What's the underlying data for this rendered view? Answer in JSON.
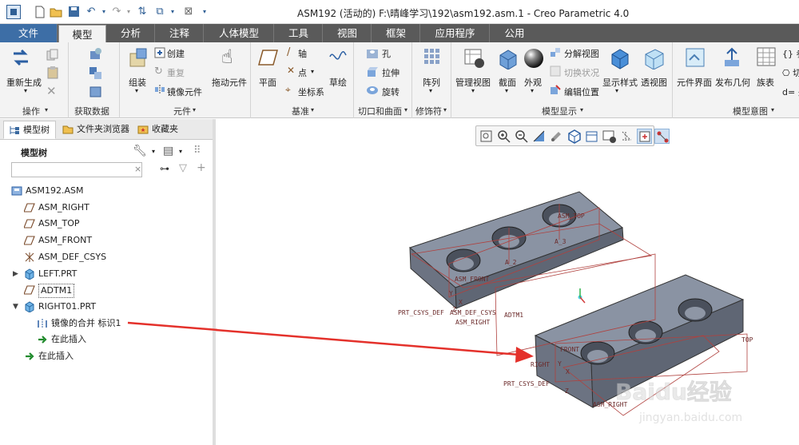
{
  "window": {
    "title": "ASM192 (活动的) F:\\晴峰学习\\192\\asm192.asm.1 - Creo Parametric 4.0"
  },
  "tabs": [
    "文件",
    "模型",
    "分析",
    "注释",
    "人体模型",
    "工具",
    "视图",
    "框架",
    "应用程序",
    "公用"
  ],
  "active_tab": "模型",
  "ribbon": {
    "groups": {
      "operations": "操作",
      "get_data": "获取数据",
      "component": "元件",
      "datum": "基准",
      "cut_surface": "切口和曲面",
      "modifier": "修饰符",
      "model_display": "模型显示",
      "model_intent": "模型意图"
    },
    "buttons": {
      "regenerate": "重新生成",
      "assemble": "组装",
      "create": "创建",
      "repeat": "重复",
      "mirror_component": "镜像元件",
      "drag_component": "拖动元件",
      "plane": "平面",
      "axis": "轴",
      "point": "点",
      "csys": "坐标系",
      "sketch": "草绘",
      "hole": "孔",
      "extrude": "拉伸",
      "revolve": "旋转",
      "pattern": "阵列",
      "manage_views": "管理视图",
      "section": "截面",
      "appearance": "外观",
      "explode_view": "分解视图",
      "toggle_state": "切换状况",
      "edit_position": "编辑位置",
      "display_style": "显示样式",
      "perspective_view": "透视图",
      "component_interface": "元件界面",
      "publish_geometry": "发布几何",
      "family_table": "族表",
      "params_short": "{} 参",
      "relations_short": "d= 关"
    }
  },
  "sidebar": {
    "tabs": [
      "模型树",
      "文件夹浏览器",
      "收藏夹"
    ],
    "model_tree_label": "模型树",
    "search_placeholder": "",
    "tree": [
      {
        "label": "ASM192.ASM",
        "icon": "assembly-icon",
        "level": 0,
        "expander": ""
      },
      {
        "label": "ASM_RIGHT",
        "icon": "datum-plane-icon",
        "level": 1,
        "expander": ""
      },
      {
        "label": "ASM_TOP",
        "icon": "datum-plane-icon",
        "level": 1,
        "expander": ""
      },
      {
        "label": "ASM_FRONT",
        "icon": "datum-plane-icon",
        "level": 1,
        "expander": ""
      },
      {
        "label": "ASM_DEF_CSYS",
        "icon": "csys-icon",
        "level": 1,
        "expander": ""
      },
      {
        "label": "LEFT.PRT",
        "icon": "part-icon",
        "level": 1,
        "expander": "▶"
      },
      {
        "label": "ADTM1",
        "icon": "datum-plane-icon",
        "level": 1,
        "expander": ""
      },
      {
        "label": "RIGHT01.PRT",
        "icon": "part-icon",
        "level": 1,
        "expander": "▼"
      },
      {
        "label": "镜像的合并 标识1",
        "icon": "mirror-merge-icon",
        "level": 2,
        "expander": ""
      },
      {
        "label": "在此插入",
        "icon": "insert-arrow-icon",
        "level": 2,
        "expander": ""
      },
      {
        "label": "在此插入",
        "icon": "insert-arrow-icon",
        "level": 1,
        "expander": ""
      }
    ]
  },
  "viewport": {
    "labels": {
      "asm_top": "ASM_TOP",
      "a3": "A_3",
      "a2": "A_2",
      "asm_front": "ASM_FRONT",
      "prt_csys_def_left": "PRT_CSYS_DEF",
      "asm_def_csys": "ASM_DEF_CSYS",
      "asm_right": "ASM_RIGHT",
      "adtm1": "ADTM1",
      "front": "FRONT",
      "top": "TOP",
      "right": "RIGHT",
      "prt_csys_def_right": "PRT_CSYS_DEF",
      "asm_right_bottom": "ASM_RIGHT",
      "axis_x": "X",
      "axis_y": "Y",
      "axis_z": "Z"
    },
    "colors": {
      "part_top": "#8a93a3",
      "part_side": "#5f6674",
      "datum": "#b0413e",
      "arrow": "#e4312b"
    }
  },
  "watermark": {
    "brand": "Baidu经验",
    "url": "jingyan.baidu.com"
  }
}
